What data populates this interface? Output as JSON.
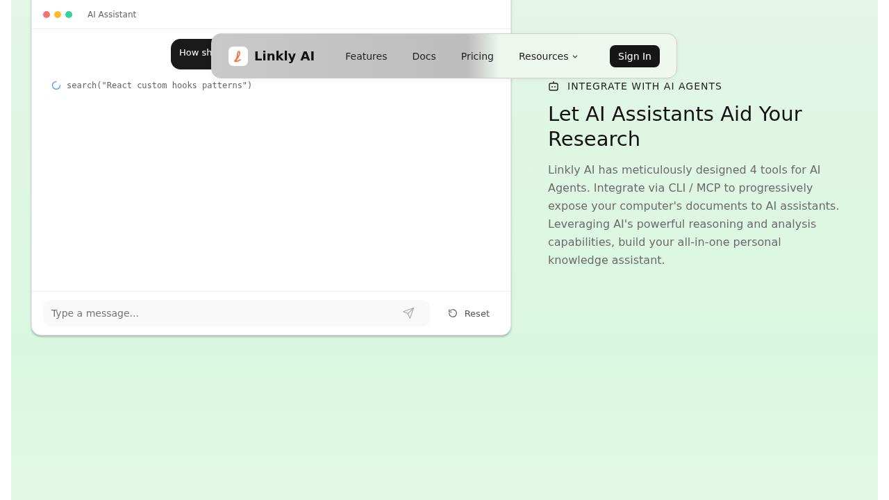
{
  "chat_window": {
    "title": "AI Assistant",
    "user_message": "How sh",
    "tool_call": "search(\"React custom hooks patterns\")",
    "input": {
      "placeholder": "Type a message..."
    },
    "reset_button": "Reset"
  },
  "navbar": {
    "brand": "Linkly AI",
    "links": [
      {
        "label": "Features",
        "dropdown": false
      },
      {
        "label": "Docs",
        "dropdown": false
      },
      {
        "label": "Pricing",
        "dropdown": false
      },
      {
        "label": "Resources",
        "dropdown": true
      }
    ],
    "sign_in": "Sign In"
  },
  "section": {
    "eyebrow": "INTEGRATE WITH AI AGENTS",
    "heading": "Let AI Assistants Aid Your Research",
    "body": "Linkly AI has meticulously designed 4 tools for AI Agents. Integrate via CLI / MCP to progressively expose your computer's documents to AI assistants. Leveraging AI's powerful reasoning and analysis capabilities, build your all-in-one personal knowledge assistant."
  }
}
